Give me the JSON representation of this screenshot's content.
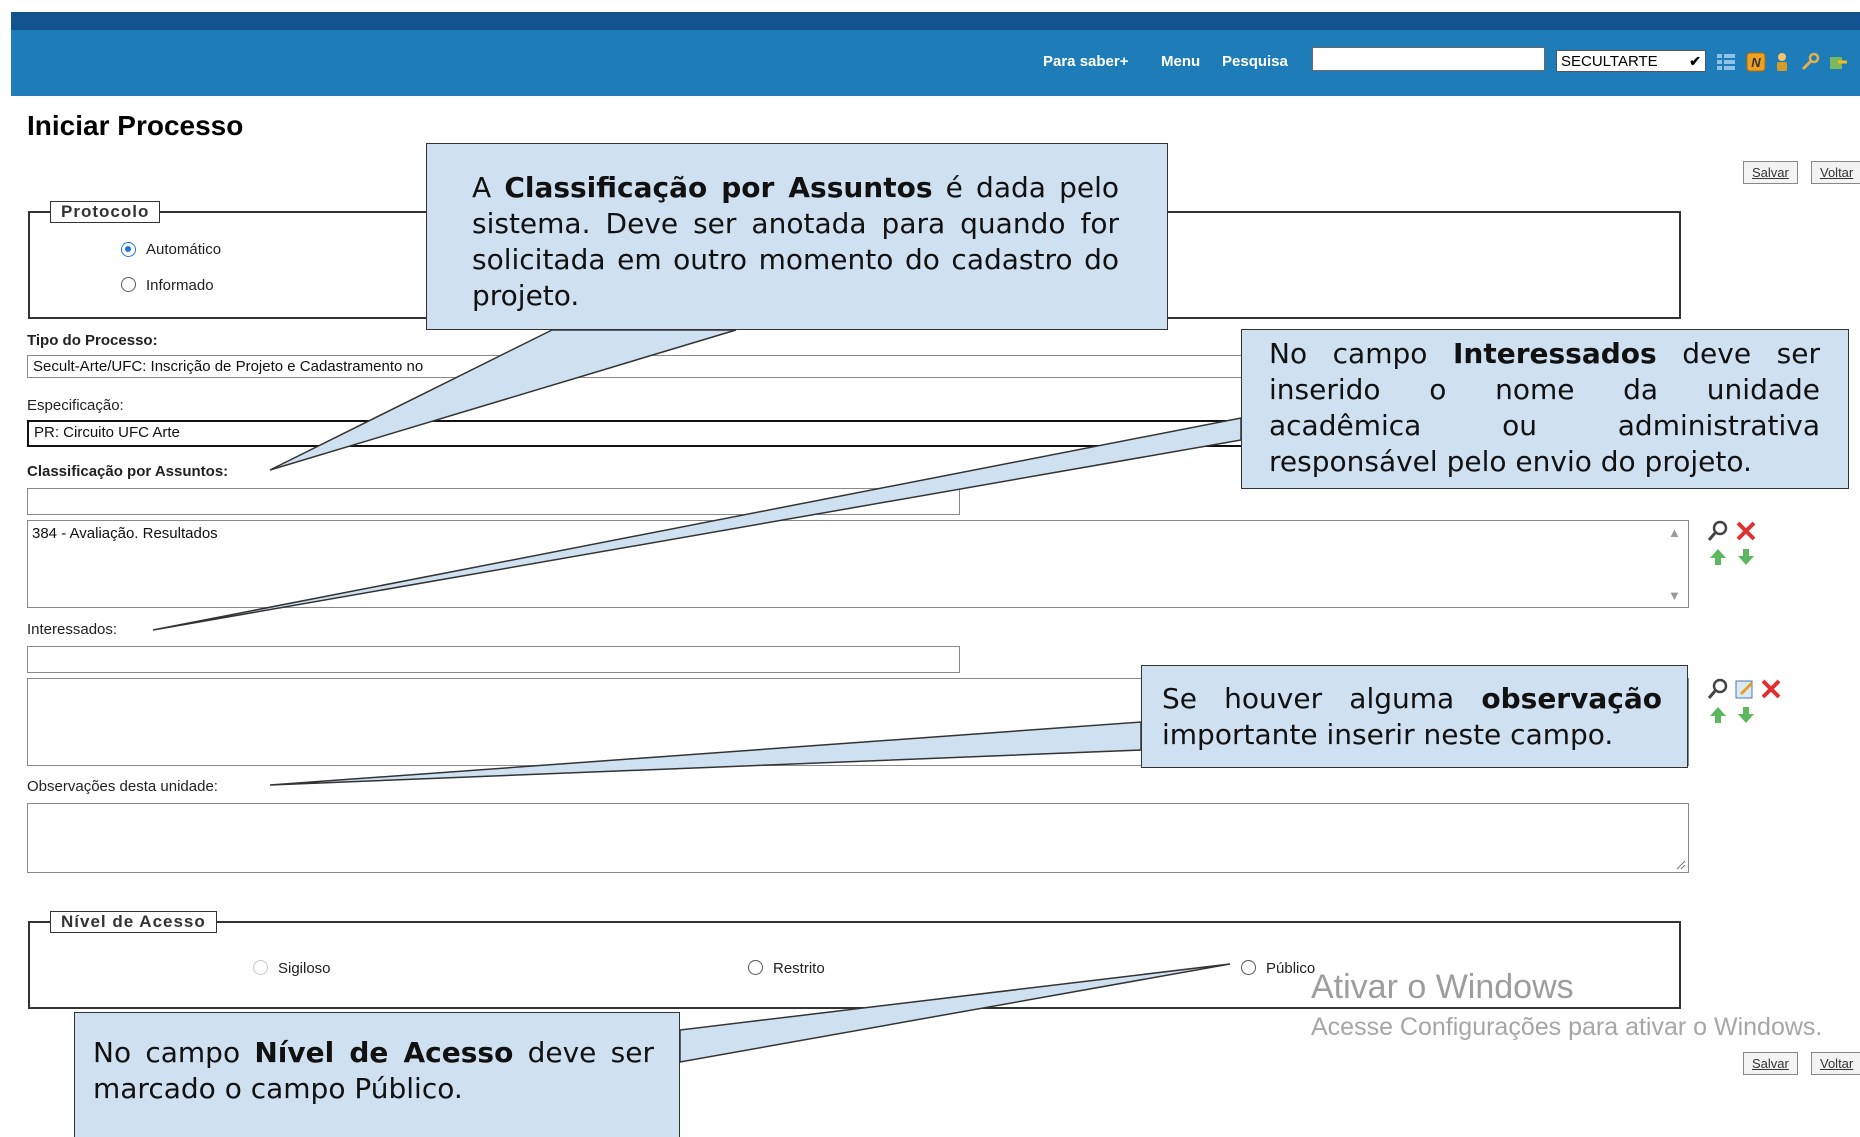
{
  "header": {
    "links": [
      "Para saber+",
      "Menu",
      "Pesquisa"
    ],
    "search_value": "",
    "unit_select": "SECULTARTE"
  },
  "page_title": "Iniciar Processo",
  "buttons": {
    "save": "Salvar",
    "back": "Voltar"
  },
  "protocolo": {
    "legend": "Protocolo",
    "options": [
      "Automático",
      "Informado"
    ],
    "selected": "Automático"
  },
  "fields": {
    "tipo_label": "Tipo do Processo:",
    "tipo_value": "Secult-Arte/UFC: Inscrição de Projeto e Cadastramento no",
    "especificacao_label": "Especificação:",
    "especificacao_value": "PR: Circuito UFC Arte",
    "classificacao_label": "Classificação por Assuntos:",
    "classificacao_item": "384 - Avaliação. Resultados",
    "interessados_label": "Interessados:",
    "observacoes_label": "Observações desta unidade:"
  },
  "nivel_acesso": {
    "legend": "Nível de Acesso",
    "options": [
      "Sigiloso",
      "Restrito",
      "Público"
    ]
  },
  "watermark": {
    "title": "Ativar o Windows",
    "subtitle": "Acesse Configurações para ativar o Windows."
  },
  "callouts": {
    "classificacao": {
      "pre": "A ",
      "bold": "Classificação por Assuntos",
      "post": " é dada pelo sistema. Deve ser anotada para quando for solicitada em outro momento do cadastro do projeto."
    },
    "interessados": {
      "pre": "No campo ",
      "bold": "Interessados",
      "post": " deve ser inserido o nome da unidade acadêmica ou administrativa responsável pelo envio do projeto."
    },
    "observacao": {
      "pre": "Se houver alguma ",
      "bold": "observação",
      "post": " importante inserir neste campo."
    },
    "nivel": {
      "pre": "No campo ",
      "bold": "Nível de Acesso",
      "post": " deve ser marcado o campo Público."
    }
  },
  "colors": {
    "navy": "#12538f",
    "bar": "#1e7db9",
    "callout": "#cfe0f1"
  },
  "icons": [
    "grid-icon",
    "n-icon",
    "user-icon",
    "wrench-icon",
    "search-icon",
    "delete-icon",
    "arrow-up-icon",
    "arrow-down-icon",
    "edit-icon"
  ]
}
